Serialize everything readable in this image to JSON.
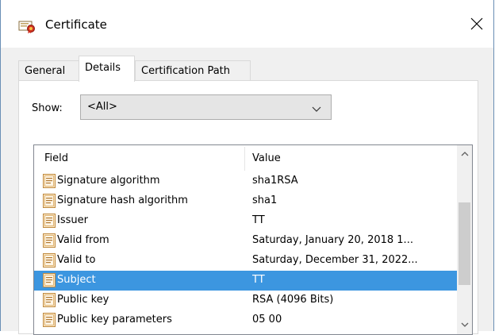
{
  "window": {
    "title": "Certificate"
  },
  "tabs": [
    {
      "label": "General"
    },
    {
      "label": "Details"
    },
    {
      "label": "Certification Path"
    }
  ],
  "show": {
    "label": "Show:",
    "selected": "<All>"
  },
  "list": {
    "columns": {
      "field": "Field",
      "value": "Value"
    },
    "rows": [
      {
        "field": "Signature algorithm",
        "value": "sha1RSA"
      },
      {
        "field": "Signature hash algorithm",
        "value": "sha1"
      },
      {
        "field": "Issuer",
        "value": "TT"
      },
      {
        "field": "Valid from",
        "value": "Saturday, January 20, 2018 1..."
      },
      {
        "field": "Valid to",
        "value": "Saturday, December 31, 2022..."
      },
      {
        "field": "Subject",
        "value": "TT",
        "selected": true
      },
      {
        "field": "Public key",
        "value": "RSA (4096 Bits)"
      },
      {
        "field": "Public key parameters",
        "value": "05 00"
      }
    ]
  },
  "icons": {
    "title": "certificate-icon",
    "row": "certificate-field-icon"
  },
  "colors": {
    "selection": "#3c96e0",
    "border": "#6a8fb5"
  }
}
